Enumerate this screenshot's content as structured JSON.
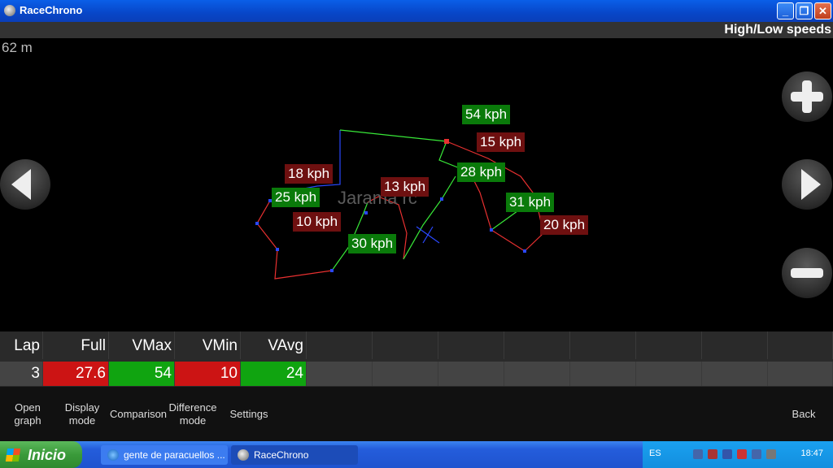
{
  "window": {
    "title": "RaceChrono",
    "minimize": "_",
    "maximize": "❐",
    "close": "✕"
  },
  "header": {
    "mode": "High/Low speeds",
    "scale": "62 m"
  },
  "map": {
    "watermark": "Jarama rc",
    "labels": [
      {
        "text": "54 kph",
        "kind": "high"
      },
      {
        "text": "15 kph",
        "kind": "low"
      },
      {
        "text": "18 kph",
        "kind": "low"
      },
      {
        "text": "28 kph",
        "kind": "high"
      },
      {
        "text": "13 kph",
        "kind": "low"
      },
      {
        "text": "25 kph",
        "kind": "high"
      },
      {
        "text": "31 kph",
        "kind": "high"
      },
      {
        "text": "10 kph",
        "kind": "low"
      },
      {
        "text": "20 kph",
        "kind": "low"
      },
      {
        "text": "30 kph",
        "kind": "high"
      }
    ]
  },
  "nav": {
    "zoom_in": "plus-icon",
    "zoom_out": "minus-icon",
    "prev": "arrow-left-icon",
    "next": "arrow-right-icon"
  },
  "table": {
    "headers": [
      "Lap",
      "Full",
      "VMax",
      "VMin",
      "VAvg"
    ],
    "row": [
      "3",
      "27.6",
      "54",
      "10",
      "24"
    ]
  },
  "toolbar": {
    "open_graph": "Open\ngraph",
    "display_mode": "Display\nmode",
    "comparison": "Comparison",
    "difference_mode": "Difference\nmode",
    "settings": "Settings",
    "back": "Back"
  },
  "taskbar": {
    "start": "Inicio",
    "tasks": [
      "gente de paracuellos ...",
      "RaceChrono"
    ],
    "lang": "ES",
    "clock": "18:47"
  },
  "colors": {
    "high": "#0a7a0a",
    "low": "#6e1010",
    "red_cell": "#cc1414",
    "green_cell": "#10a410"
  }
}
